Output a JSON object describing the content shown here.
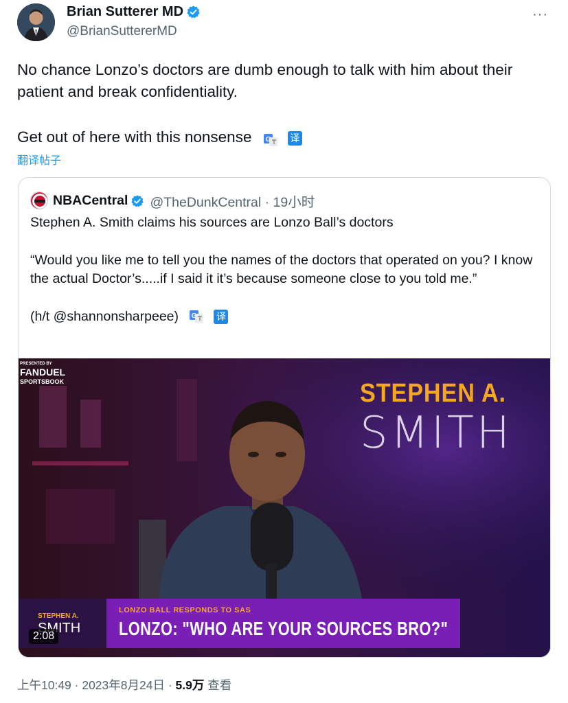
{
  "author": {
    "name": "Brian Sutterer MD",
    "handle": "@BrianSuttererMD",
    "avatar_icon": "person-avatar",
    "verified_color": "#1d9bf0"
  },
  "more_label": "···",
  "tweet": {
    "line1": "No chance Lonzo’s doctors are dumb enough to talk with him about their patient and break confidentiality.",
    "line2": "Get out of here with this nonsense",
    "translate_badge": "译",
    "translate_link": "翻译帖子"
  },
  "quote": {
    "name": "NBACentral",
    "handle_time": "@TheDunkCentral · 19小时",
    "para1": "Stephen A. Smith claims his sources are Lonzo Ball’s doctors",
    "para2": "“Would you like me to tell you the names of the doctors that operated on you? I know the actual Doctor’s.....if I said it it’s because someone close to you told me.”",
    "para3": "(h/t @shannonsharpeee)",
    "translate_badge": "译"
  },
  "video": {
    "sponsor_small": "PRESENTED BY",
    "sponsor_line1": "FANDUEL",
    "sponsor_line2": "SPORTSBOOK",
    "show_title_top": "STEPHEN A.",
    "show_title_bottom": "SMITH",
    "lower_third_sub": "LONZO BALL RESPONDS TO SAS",
    "lower_third_main": "LONZO: \"WHO ARE YOUR SOURCES BRO?\"",
    "logo_small": "STEPHEN A.",
    "logo_big": "SMITH",
    "duration": "2:08"
  },
  "meta": {
    "time_date": "上午10:49 · 2023年8月24日 · ",
    "views_count": "5.9万",
    "views_label": " 查看"
  },
  "colors": {
    "accent": "#1d9bf0",
    "lower_third": "#7a1fb5",
    "highlight": "#f5a623"
  }
}
